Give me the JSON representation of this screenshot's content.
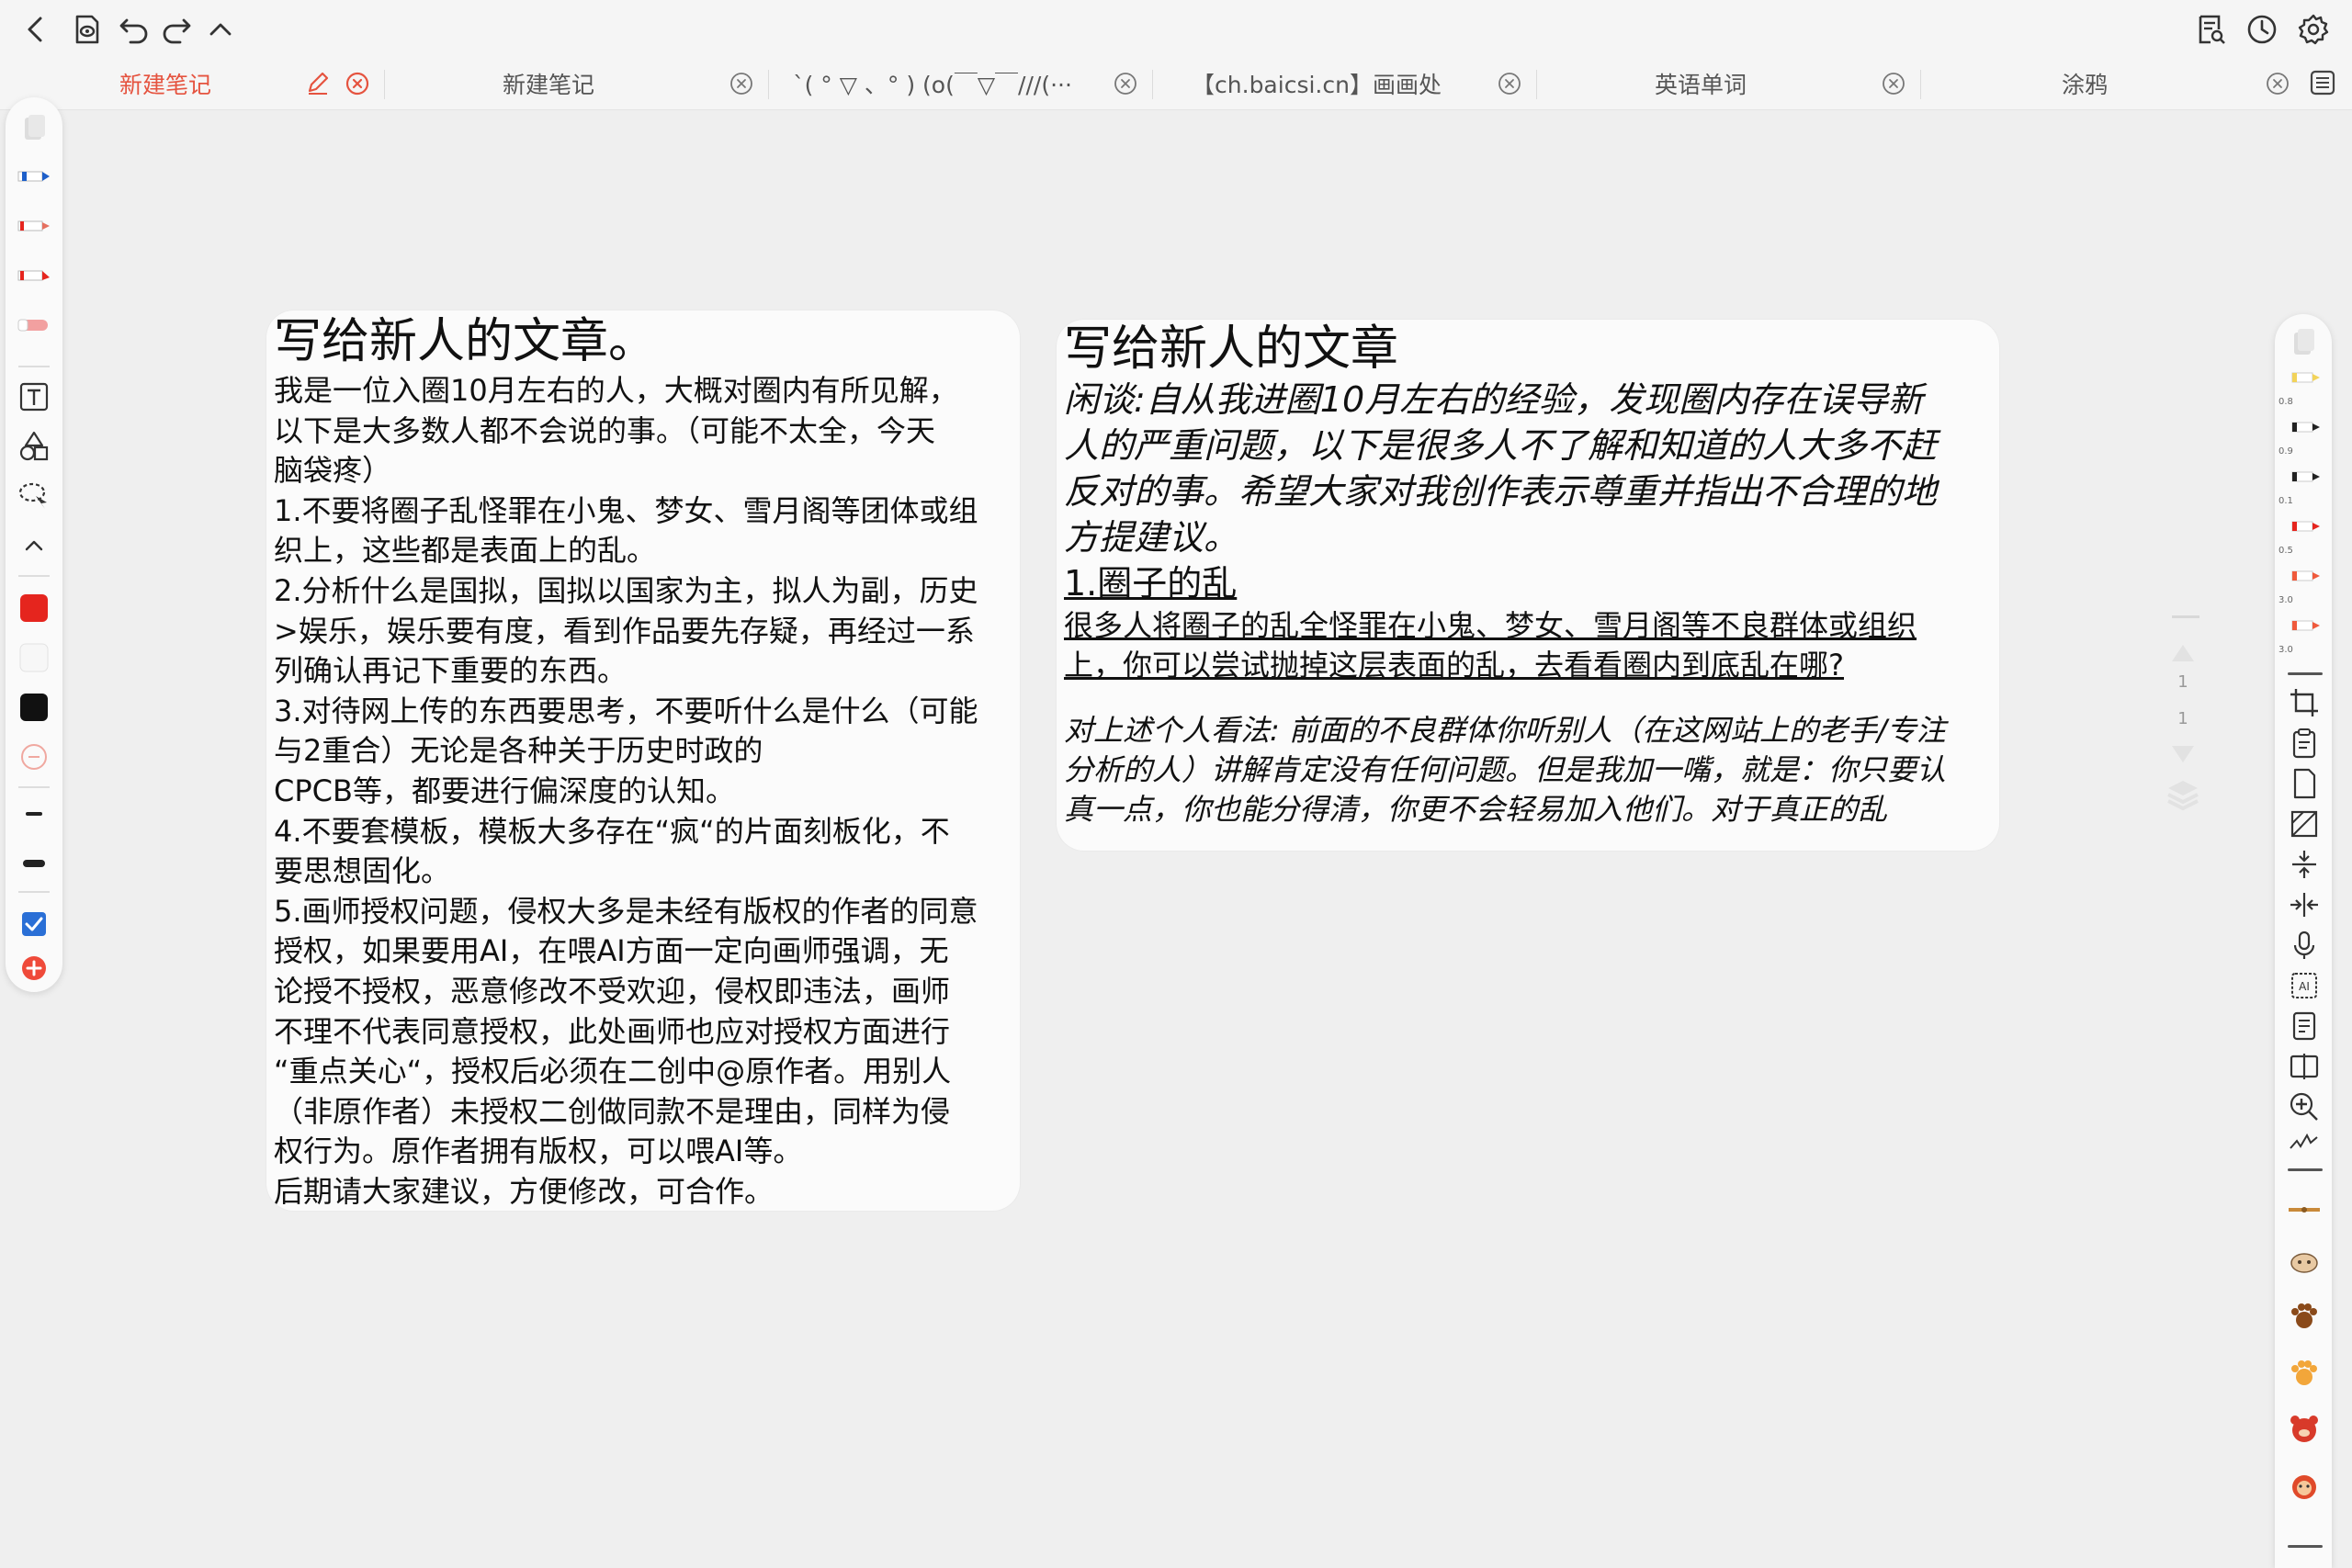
{
  "colors": {
    "accent": "#e5533f",
    "background": "#efefef",
    "card": "#fbfbfb",
    "red_swatch": "#e5251e",
    "black_swatch": "#111111",
    "checkbox_blue": "#2a6fd6"
  },
  "tabs": [
    {
      "label": "新建笔记",
      "active": true
    },
    {
      "label": "新建笔记",
      "active": false
    },
    {
      "label": "`( ° ▽ 、° ) (o(￣▽￣///(···",
      "active": false
    },
    {
      "label": "【ch.baicsi.cn】画画处",
      "active": false
    },
    {
      "label": "英语单词",
      "active": false
    },
    {
      "label": "涂鸦",
      "active": false
    }
  ],
  "page_scroller": {
    "current": "1",
    "total": "1"
  },
  "right_toolbar": {
    "pen_sizes": [
      "0.8",
      "0.9",
      "0.1",
      "0.5",
      "3.0",
      "3.0"
    ]
  },
  "card_left": {
    "title": "写给新人的文章。",
    "lines": [
      "我是一位入圈10月左右的人，大概对圈内有所见解，",
      "以下是大多数人都不会说的事。（可能不太全，今天",
      "脑袋疼）",
      "1.不要将圈子乱怪罪在小鬼、梦女、雪月阁等团体或组",
      "织上，这些都是表面上的乱。",
      "2.分析什么是国拟，国拟以国家为主，拟人为副，历史",
      ">娱乐，娱乐要有度，看到作品要先存疑，再经过一系",
      "列确认再记下重要的东西。",
      "3.对待网上传的东西要思考，不要听什么是什么（可能",
      "与2重合）无论是各种关于历史时政的",
      "CPCB等，都要进行偏深度的认知。",
      "4.不要套模板，模板大多存在“疯“的片面刻板化，不",
      "要思想固化。",
      "5.画师授权问题，侵权大多是未经有版权的作者的同意",
      "授权，如果要用AI，在喂AI方面一定向画师强调，无",
      "论授不授权，恶意修改不受欢迎，侵权即违法，画师",
      "不理不代表同意授权，此处画师也应对授权方面进行",
      "“重点关心“，授权后必须在二创中@原作者。用别人",
      "（非原作者）未授权二创做同款不是理由，同样为侵",
      "权行为。原作者拥有版权，可以喂AI等。",
      "后期请大家建议，方便修改，可合作。"
    ]
  },
  "card_right": {
    "title": "写给新人的文章",
    "intro_lines": [
      "闲谈:自从我进圈10月左右的经验，发现圈内存在误导新",
      "人的严重问题，以下是很多人不了解和知道的人大多不赶",
      "反对的事。希望大家对我创作表示尊重并指出不合理的地",
      "方提建议。"
    ],
    "section_heading": "1.圈子的乱",
    "underlined_lines": [
      "很多人将圈子的乱全怪罪在小鬼、梦女、雪月阁等不良群体或组织",
      "上，你可以尝试抛掉这层表面的乱，去看看圈内到底乱在哪?"
    ],
    "italic_lines": [
      "对上述个人看法: 前面的不良群体你听别人（在这网站上的老手/专注",
      "分析的人）讲解肯定没有任何问题。但是我加一嘴，就是：你只要认",
      "真一点，你也能分得清，你更不会轻易加入他们。对于真正的乱"
    ]
  }
}
